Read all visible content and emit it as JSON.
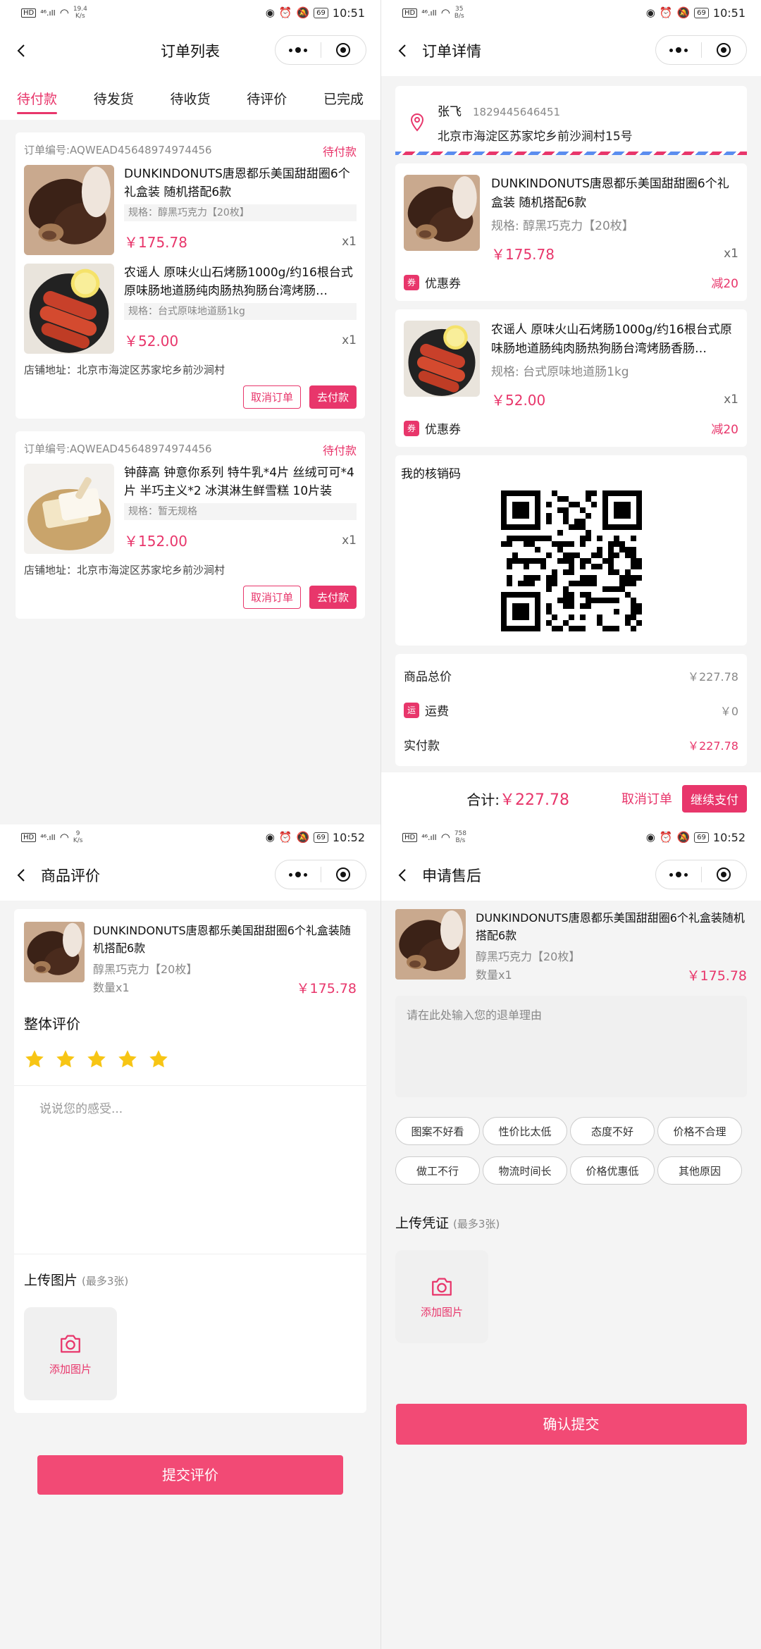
{
  "colors": {
    "accent": "#e8366b",
    "button": "#f24a75",
    "star": "#f7c514"
  },
  "order_list": {
    "status": {
      "speed": "19.4",
      "speed_unit": "K/s",
      "battery": "69",
      "time": "10:51"
    },
    "title": "订单列表",
    "tabs": [
      "待付款",
      "待发货",
      "待收货",
      "待评价",
      "已完成"
    ],
    "orders": [
      {
        "order_no": "订单编号:AQWEAD45648974974456",
        "status": "待付款",
        "items": [
          {
            "name": "DUNKINDONUTS唐恩都乐美国甜甜圈6个礼盒装 随机搭配6款",
            "spec": "规格：醇黑巧克力【20枚】",
            "price": "￥175.78",
            "qty": "x1"
          },
          {
            "name": "农谣人 原味火山石烤肠1000g/约16根台式原味肠地道肠纯肉肠热狗肠台湾烤肠…",
            "spec": "规格：台式原味地道肠1kg",
            "price": "￥52.00",
            "qty": "x1"
          }
        ],
        "shop_addr": "店铺地址：北京市海淀区苏家坨乡前沙涧村",
        "cancel": "取消订单",
        "pay": "去付款"
      },
      {
        "order_no": "订单编号:AQWEAD45648974974456",
        "status": "待付款",
        "items": [
          {
            "name": "钟薛高 钟意你系列 特牛乳*4片 丝绒可可*4片 半巧主义*2 冰淇淋生鲜雪糕 10片装",
            "spec": "规格：暂无规格",
            "price": "￥152.00",
            "qty": "x1"
          }
        ],
        "shop_addr": "店铺地址：北京市海淀区苏家坨乡前沙涧村",
        "cancel": "取消订单",
        "pay": "去付款"
      }
    ]
  },
  "order_detail": {
    "status": {
      "speed": "35",
      "speed_unit": "B/s",
      "battery": "69",
      "time": "10:51"
    },
    "title": "订单详情",
    "address": {
      "name": "张飞",
      "phone": "1829445646451",
      "text": "北京市海淀区苏家坨乡前沙涧村15号"
    },
    "items": [
      {
        "name": "DUNKINDONUTS唐恩都乐美国甜甜圈6个礼盒装 随机搭配6款",
        "spec": "规格: 醇黑巧克力【20枚】",
        "price": "￥175.78",
        "qty": "x1",
        "coupon_tag": "券",
        "coupon_label": "优惠券",
        "coupon_value": "减20"
      },
      {
        "name": "农谣人 原味火山石烤肠1000g/约16根台式原味肠地道肠纯肉肠热狗肠台湾烤肠香肠…",
        "spec": "规格: 台式原味地道肠1kg",
        "price": "￥52.00",
        "qty": "x1",
        "coupon_tag": "券",
        "coupon_label": "优惠券",
        "coupon_value": "减20"
      }
    ],
    "qr_title": "我的核销码",
    "summary": {
      "goods_total_label": "商品总价",
      "goods_total": "￥227.78",
      "shipping_tag": "运",
      "shipping_label": "运费",
      "shipping": "￥0",
      "paid_label": "实付款",
      "paid": "￥227.78"
    },
    "bottom": {
      "total_label": "合计:",
      "total": "￥227.78",
      "cancel": "取消订单",
      "pay": "继续支付"
    }
  },
  "review": {
    "status": {
      "speed": "9",
      "speed_unit": "K/s",
      "battery": "69",
      "time": "10:52"
    },
    "title": "商品评价",
    "product": {
      "name": "DUNKINDONUTS唐恩都乐美国甜甜圈6个礼盒装随机搭配6款",
      "spec": "醇黑巧克力【20枚】",
      "qty": "数量x1",
      "price": "￥175.78"
    },
    "overall_label": "整体评价",
    "rating": 5,
    "placeholder": "说说您的感受...",
    "upload_label": "上传图片",
    "upload_hint": "(最多3张)",
    "add_photo": "添加图片",
    "submit": "提交评价"
  },
  "after_sale": {
    "status": {
      "speed": "758",
      "speed_unit": "B/s",
      "battery": "69",
      "time": "10:52"
    },
    "title": "申请售后",
    "product": {
      "name": "DUNKINDONUTS唐恩都乐美国甜甜圈6个礼盒装随机搭配6款",
      "spec": "醇黑巧克力【20枚】",
      "qty": "数量x1",
      "price": "￥175.78"
    },
    "reason_placeholder": "请在此处输入您的退单理由",
    "reasons": [
      "图案不好看",
      "性价比太低",
      "态度不好",
      "价格不合理",
      "做工不行",
      "物流时间长",
      "价格优惠低",
      "其他原因"
    ],
    "upload_label": "上传凭证",
    "upload_hint": "(最多3张)",
    "add_photo": "添加图片",
    "submit": "确认提交"
  }
}
